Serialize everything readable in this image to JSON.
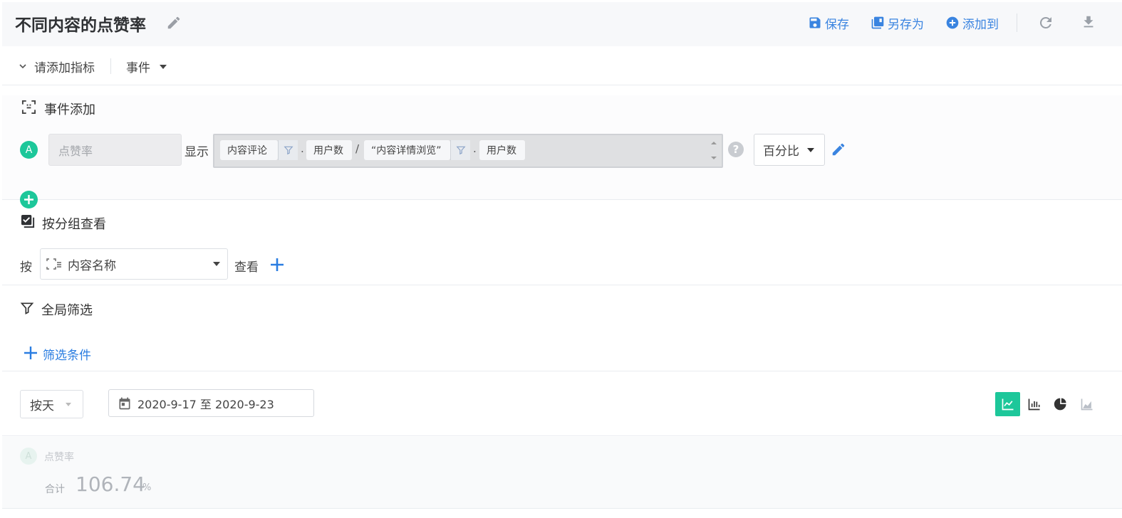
{
  "header": {
    "title": "不同内容的点赞率",
    "actions": {
      "save": "保存",
      "save_as": "另存为",
      "add_to": "添加到"
    }
  },
  "metrics_bar": {
    "add_metric": "请添加指标",
    "events_menu": "事件"
  },
  "event_section": {
    "title": "事件添加",
    "metric": {
      "badge": "A",
      "name_placeholder": "点赞率",
      "display_label": "显示",
      "formula": {
        "numerator_event": "内容评论",
        "numerator_measure": "用户数",
        "divider": "/",
        "denominator_event": "“内容详情浏览”",
        "denominator_measure": "用户数",
        "dot": "."
      },
      "help": "?",
      "format": "百分比"
    }
  },
  "group_section": {
    "title": "按分组查看",
    "prefix": "按",
    "selected": "内容名称",
    "suffix": "查看"
  },
  "filter_section": {
    "title": "全局筛选",
    "add_condition": "筛选条件"
  },
  "query": {
    "interval": "按天",
    "date_range": "2020-9-17 至 2020-9-23"
  },
  "summary": {
    "badge": "A",
    "metric_name": "点赞率",
    "total_label": "合计",
    "total_value": "106.74",
    "total_unit": "%"
  },
  "colors": {
    "accent_blue": "#3a84e0",
    "accent_green": "#1dc79a"
  }
}
